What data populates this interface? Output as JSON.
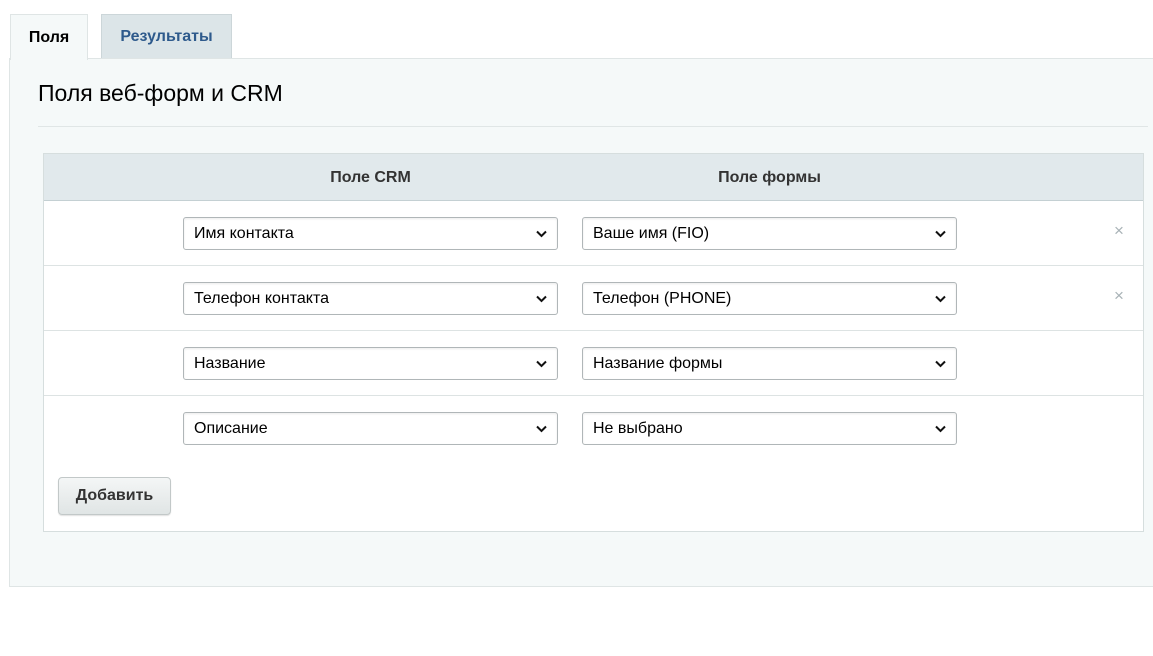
{
  "tabs": [
    {
      "label": "Поля",
      "active": true
    },
    {
      "label": "Результаты",
      "active": false
    }
  ],
  "section_title": "Поля веб-форм и CRM",
  "table": {
    "headers": {
      "crm": "Поле CRM",
      "form": "Поле формы"
    },
    "rows": [
      {
        "crm": "Имя контакта",
        "form": "Ваше имя (FIO)",
        "removable": true,
        "remove_icon": "×"
      },
      {
        "crm": "Телефон контакта",
        "form": "Телефон (PHONE)",
        "removable": true,
        "remove_icon": "×"
      },
      {
        "crm": "Название",
        "form": "Название формы",
        "removable": false
      },
      {
        "crm": "Описание",
        "form": "Не выбрано",
        "removable": false
      }
    ]
  },
  "add_button": "Добавить",
  "colors": {
    "accent_tab_text": "#2e5a8c",
    "header_bg": "#e1e9ec",
    "panel_bg": "#f5f9f9"
  }
}
